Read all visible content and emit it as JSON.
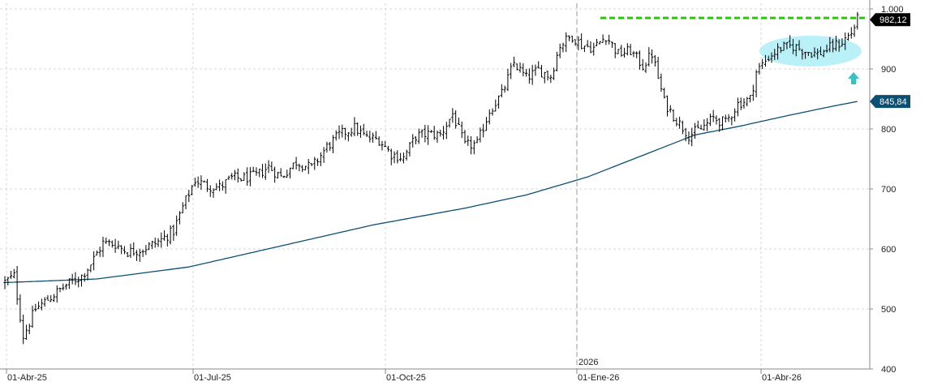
{
  "chart_data": {
    "type": "ohlc",
    "title": "",
    "x_axis": {
      "tick_labels": [
        "01-Abr-25",
        "01-Jul-25",
        "01-Oct-25",
        "01-Ene-26",
        "01-Abr-26"
      ],
      "year_marker": "2026"
    },
    "y_axis": {
      "range": [
        400,
        1000
      ],
      "tick_labels": [
        "1.000",
        "900",
        "800",
        "700",
        "600",
        "500",
        "400"
      ],
      "tick_values": [
        1000,
        900,
        800,
        700,
        600,
        500,
        400
      ],
      "grid": true
    },
    "last_price_label": "982,12",
    "last_price_value": 982.12,
    "moving_average_label": "845,84",
    "moving_average_value": 845.84,
    "resistance_level": 985,
    "price_anchors": [
      [
        0,
        545
      ],
      [
        3,
        555
      ],
      [
        6,
        455
      ],
      [
        10,
        500
      ],
      [
        15,
        520
      ],
      [
        20,
        540
      ],
      [
        25,
        555
      ],
      [
        28,
        575
      ],
      [
        32,
        610
      ],
      [
        36,
        608
      ],
      [
        40,
        595
      ],
      [
        45,
        600
      ],
      [
        50,
        612
      ],
      [
        55,
        630
      ],
      [
        58,
        670
      ],
      [
        62,
        715
      ],
      [
        66,
        705
      ],
      [
        70,
        703
      ],
      [
        74,
        718
      ],
      [
        78,
        718
      ],
      [
        82,
        722
      ],
      [
        86,
        737
      ],
      [
        90,
        720
      ],
      [
        95,
        745
      ],
      [
        100,
        735
      ],
      [
        105,
        770
      ],
      [
        109,
        790
      ],
      [
        114,
        802
      ],
      [
        118,
        785
      ],
      [
        122,
        782
      ],
      [
        126,
        758
      ],
      [
        130,
        752
      ],
      [
        134,
        788
      ],
      [
        138,
        792
      ],
      [
        142,
        790
      ],
      [
        146,
        825
      ],
      [
        150,
        772
      ],
      [
        154,
        775
      ],
      [
        158,
        830
      ],
      [
        162,
        858
      ],
      [
        166,
        910
      ],
      [
        170,
        885
      ],
      [
        174,
        898
      ],
      [
        178,
        888
      ],
      [
        181,
        940
      ],
      [
        185,
        955
      ],
      [
        188,
        940
      ],
      [
        192,
        935
      ],
      [
        196,
        955
      ],
      [
        200,
        925
      ],
      [
        204,
        930
      ],
      [
        208,
        905
      ],
      [
        211,
        925
      ],
      [
        215,
        845
      ],
      [
        219,
        815
      ],
      [
        223,
        790
      ],
      [
        227,
        800
      ],
      [
        231,
        818
      ],
      [
        235,
        810
      ],
      [
        239,
        842
      ],
      [
        243,
        850
      ],
      [
        245,
        895
      ],
      [
        249,
        920
      ],
      [
        253,
        935
      ],
      [
        257,
        938
      ],
      [
        261,
        930
      ],
      [
        265,
        925
      ],
      [
        269,
        935
      ],
      [
        273,
        945
      ],
      [
        276,
        960
      ],
      [
        278,
        982.12
      ]
    ],
    "ma_anchors": [
      [
        0,
        544
      ],
      [
        30,
        550
      ],
      [
        60,
        570
      ],
      [
        90,
        605
      ],
      [
        120,
        640
      ],
      [
        150,
        668
      ],
      [
        170,
        690
      ],
      [
        190,
        720
      ],
      [
        210,
        760
      ],
      [
        225,
        790
      ],
      [
        240,
        805
      ],
      [
        255,
        822
      ],
      [
        270,
        838
      ],
      [
        278,
        845.84
      ]
    ],
    "bar_count": 279
  },
  "colors": {
    "background": "#ffffff",
    "bars": "#000000",
    "moving_average": "#0b4f73",
    "resistance": "#22cc00",
    "highlight": "#b3f0f7",
    "arrow": "#35c3c3",
    "grid": "#d7d7d7",
    "axis": "#888888",
    "label_box": "#0b4f73",
    "last_box": "#000000"
  }
}
